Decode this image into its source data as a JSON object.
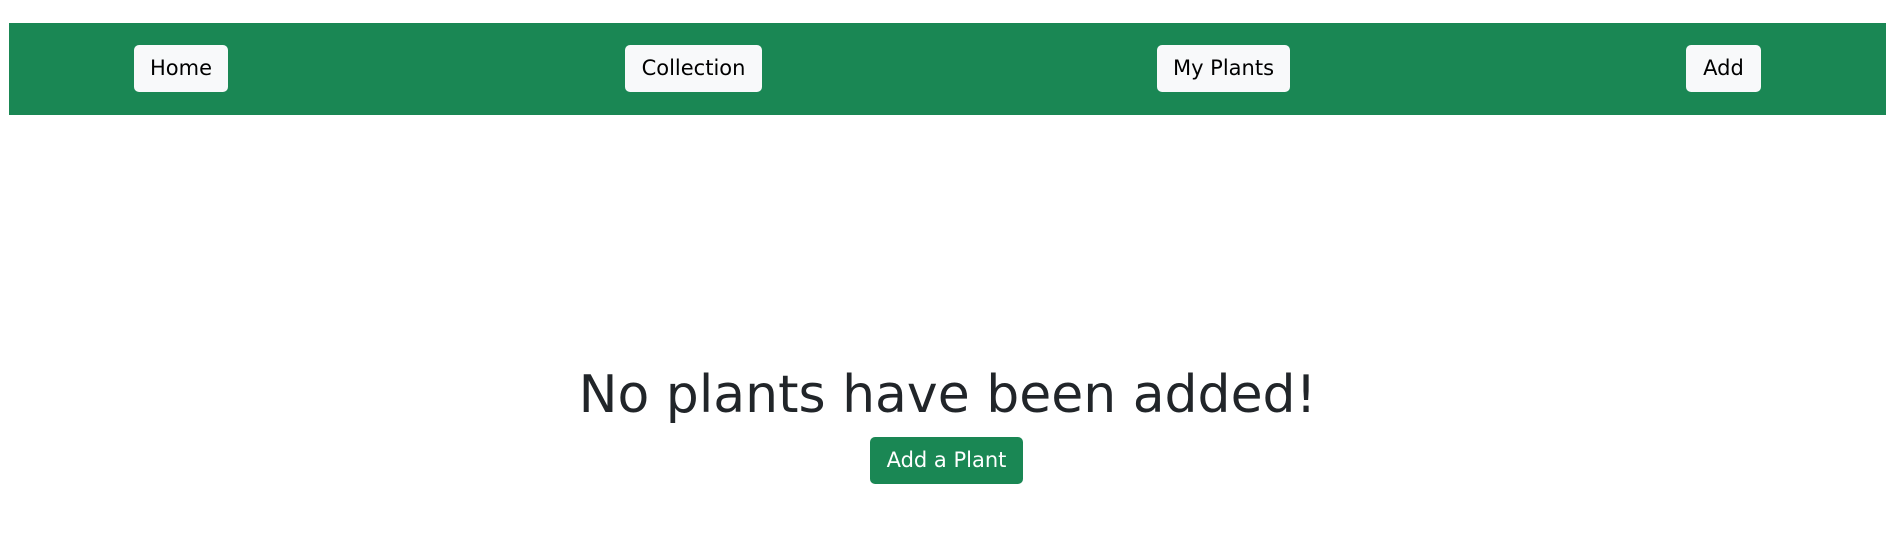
{
  "colors": {
    "brand_green": "#1a8754",
    "nav_button_bg": "#f8f9fa",
    "text_dark": "#212529",
    "white": "#ffffff"
  },
  "navbar": {
    "items": [
      {
        "label": "Home"
      },
      {
        "label": "Collection"
      },
      {
        "label": "My Plants"
      },
      {
        "label": "Add"
      }
    ]
  },
  "main": {
    "empty_message": "No plants have been added!",
    "add_button_label": "Add a Plant"
  }
}
